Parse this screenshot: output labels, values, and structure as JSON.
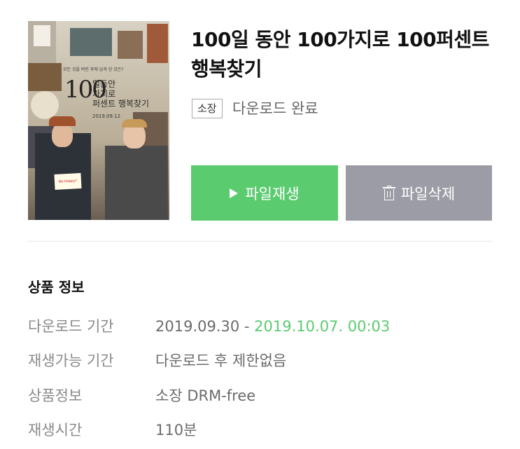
{
  "product": {
    "title": "100일 동안 100가지로 100퍼센트 행복찾기",
    "ownership_badge": "소장",
    "download_status": "다운로드 완료"
  },
  "poster": {
    "tagline": "모든 것을 버린 후에 남게 된 것은?",
    "num": "100",
    "title_line1": "일동안",
    "title_line2": "가지로",
    "title_line3": "퍼센트 행복찾기",
    "date": "2019.09.12",
    "sign_text": "Be Happy!"
  },
  "actions": {
    "play_label": "파일재생",
    "delete_label": "파일삭제"
  },
  "info": {
    "section_title": "상품 정보",
    "rows": [
      {
        "label": "다운로드 기간",
        "value_start": "2019.09.30 - ",
        "value_end": "2019.10.07. 00:03"
      },
      {
        "label": "재생가능 기간",
        "value": "다운로드 후 제한없음"
      },
      {
        "label": "상품정보",
        "value": "소장 DRM-free"
      },
      {
        "label": "재생시간",
        "value": "110분"
      }
    ]
  },
  "colors": {
    "play_button": "#5bcb70",
    "delete_button": "#9c9ca6",
    "highlight": "#5bcb70"
  }
}
